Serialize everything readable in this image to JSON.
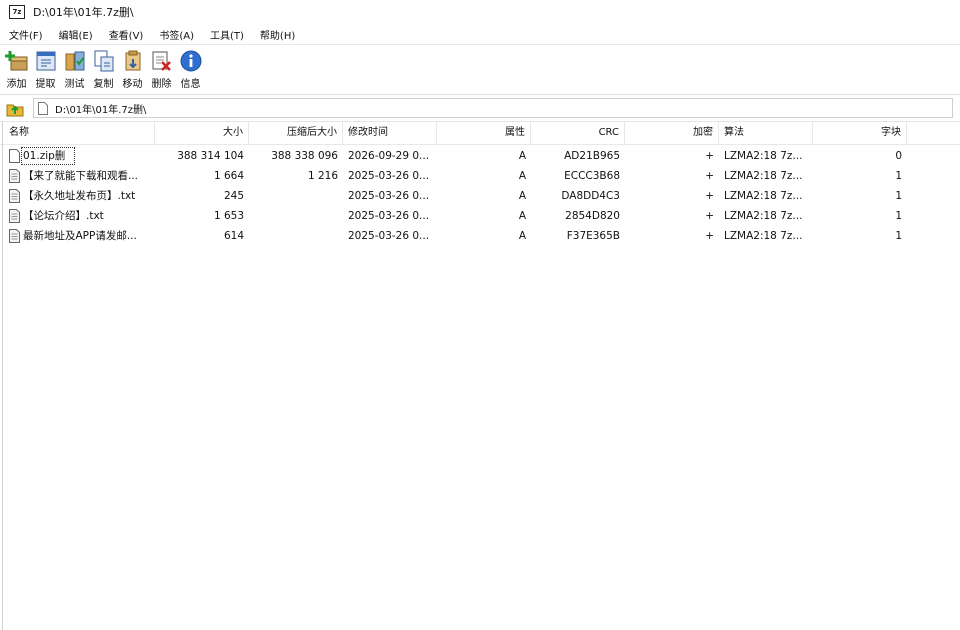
{
  "window": {
    "title": "D:\\01年\\01年.7z删\\",
    "app_icon": "7z"
  },
  "menu": [
    {
      "label": "文件(F)",
      "name": "menu-file"
    },
    {
      "label": "编辑(E)",
      "name": "menu-edit"
    },
    {
      "label": "查看(V)",
      "name": "menu-view"
    },
    {
      "label": "书签(A)",
      "name": "menu-bookmarks"
    },
    {
      "label": "工具(T)",
      "name": "menu-tools"
    },
    {
      "label": "帮助(H)",
      "name": "menu-help"
    }
  ],
  "toolbar": [
    {
      "label": "添加",
      "icon": "add-icon",
      "name": "add-button"
    },
    {
      "label": "提取",
      "icon": "extract-icon",
      "name": "extract-button"
    },
    {
      "label": "测试",
      "icon": "test-icon",
      "name": "test-button"
    },
    {
      "label": "复制",
      "icon": "copy-icon",
      "name": "copy-button"
    },
    {
      "label": "移动",
      "icon": "move-icon",
      "name": "move-button"
    },
    {
      "label": "删除",
      "icon": "delete-icon",
      "name": "delete-button"
    },
    {
      "label": "信息",
      "icon": "info-icon",
      "name": "info-button"
    }
  ],
  "address": {
    "path": "D:\\01年\\01年.7z删\\"
  },
  "columns": {
    "name": "名称",
    "size": "大小",
    "packed": "压缩后大小",
    "modified": "修改时间",
    "attr": "属性",
    "crc": "CRC",
    "encrypted": "加密",
    "method": "算法",
    "block": "字块"
  },
  "files": [
    {
      "name": "01.zip删",
      "size": "388 314 104",
      "packed": "388 338 096",
      "modified": "2026-09-29 0...",
      "attr": "A",
      "crc": "AD21B965",
      "encrypted": "+",
      "method": "LZMA2:18 7z...",
      "block": "0"
    },
    {
      "name": "【来了就能下载和观看...",
      "size": "1 664",
      "packed": "1 216",
      "modified": "2025-03-26 0...",
      "attr": "A",
      "crc": "ECCC3B68",
      "encrypted": "+",
      "method": "LZMA2:18 7z...",
      "block": "1"
    },
    {
      "name": "【永久地址发布页】.txt",
      "size": "245",
      "packed": "",
      "modified": "2025-03-26 0...",
      "attr": "A",
      "crc": "DA8DD4C3",
      "encrypted": "+",
      "method": "LZMA2:18 7z...",
      "block": "1"
    },
    {
      "name": "【论坛介绍】.txt",
      "size": "1 653",
      "packed": "",
      "modified": "2025-03-26 0...",
      "attr": "A",
      "crc": "2854D820",
      "encrypted": "+",
      "method": "LZMA2:18 7z...",
      "block": "1"
    },
    {
      "name": "最新地址及APP请发邮...",
      "size": "614",
      "packed": "",
      "modified": "2025-03-26 0...",
      "attr": "A",
      "crc": "F37E365B",
      "encrypted": "+",
      "method": "LZMA2:18 7z...",
      "block": "1"
    }
  ]
}
